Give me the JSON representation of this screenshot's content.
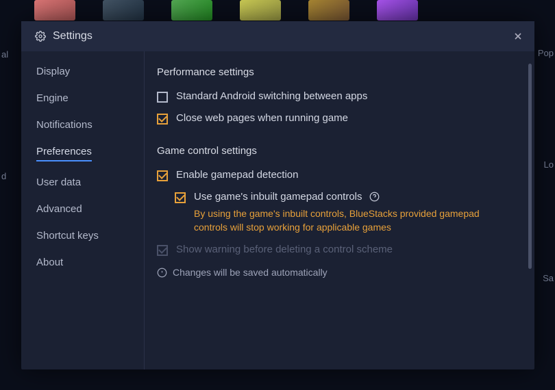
{
  "bg_side_text": {
    "left1": "al",
    "left2": "d",
    "right1": "Pop",
    "right2": "Lo",
    "right3": "Sa"
  },
  "dialog": {
    "title": "Settings"
  },
  "sidebar": {
    "items": [
      {
        "label": "Display",
        "active": false
      },
      {
        "label": "Engine",
        "active": false
      },
      {
        "label": "Notifications",
        "active": false
      },
      {
        "label": "Preferences",
        "active": true
      },
      {
        "label": "User data",
        "active": false
      },
      {
        "label": "Advanced",
        "active": false
      },
      {
        "label": "Shortcut keys",
        "active": false
      },
      {
        "label": "About",
        "active": false
      }
    ]
  },
  "content": {
    "section1_title": "Performance settings",
    "opt_standard_switch": "Standard Android switching between apps",
    "opt_close_web": "Close web pages when running game",
    "section2_title": "Game control settings",
    "opt_gamepad_detect": "Enable gamepad detection",
    "opt_inbuilt_controls": "Use game's inbuilt gamepad controls",
    "inbuilt_warning": "By using the game's inbuilt controls, BlueStacks provided gamepad controls will stop working for applicable games",
    "opt_show_warning": "Show warning before deleting a control scheme",
    "footer_note": "Changes will be saved automatically"
  }
}
